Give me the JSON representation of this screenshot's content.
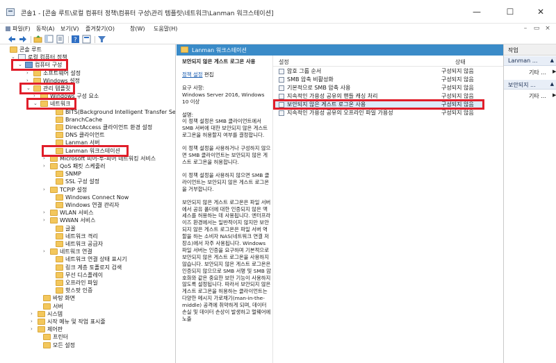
{
  "window": {
    "title": "콘솔1 - [콘솔 루트\\로컬 컴퓨터 정책\\컴퓨터 구성\\관리 템플릿\\네트워크\\Lanman 워크스테이션]",
    "minimize": "—",
    "maximize": "☐",
    "close": "✕"
  },
  "menubar": {
    "items": [
      "파일(F)",
      "동작(A)",
      "보기(V)",
      "즐겨찾기(O)",
      "창(W)",
      "도움말(H)"
    ],
    "mdi": [
      "–",
      "▭",
      "×"
    ]
  },
  "tree": {
    "rows": [
      {
        "label": "콘솔 루트",
        "exp": "",
        "icon": "folder"
      },
      {
        "label": "로컬 컴퓨터 정책",
        "exp": "⌄",
        "icon": "policy"
      },
      {
        "label": "컴퓨터 구성",
        "exp": "⌄",
        "icon": "computer"
      },
      {
        "label": "소프트웨어 설정",
        "exp": "›",
        "icon": "folder"
      },
      {
        "label": "Windows 설정",
        "exp": "›",
        "icon": "folder"
      },
      {
        "label": "관리 템플릿",
        "exp": "⌄",
        "icon": "folder"
      },
      {
        "label": "Windows 구성 요소",
        "exp": "›",
        "icon": "folder"
      },
      {
        "label": "네트워크",
        "exp": "⌄",
        "icon": "folder"
      },
      {
        "label": "BITS(Background Intelligent Transfer Service)",
        "exp": "",
        "icon": "folder"
      },
      {
        "label": "BranchCache",
        "exp": "",
        "icon": "folder"
      },
      {
        "label": "DirectAccess 클라이언트 환경 설정",
        "exp": "",
        "icon": "folder"
      },
      {
        "label": "DNS 클라이언트",
        "exp": "",
        "icon": "folder"
      },
      {
        "label": "Lanman 서버",
        "exp": "",
        "icon": "folder"
      },
      {
        "label": "Lanman 워크스테이션",
        "exp": "",
        "icon": "folder"
      },
      {
        "label": "Microsoft 피어-투-피어 네트워킹 서비스",
        "exp": "›",
        "icon": "folder"
      },
      {
        "label": "QoS 패킷 스케줄러",
        "exp": "›",
        "icon": "folder"
      },
      {
        "label": "SNMP",
        "exp": "",
        "icon": "folder"
      },
      {
        "label": "SSL 구성 설정",
        "exp": "",
        "icon": "folder"
      },
      {
        "label": "TCPIP 설정",
        "exp": "›",
        "icon": "folder"
      },
      {
        "label": "Windows Connect Now",
        "exp": "",
        "icon": "folder"
      },
      {
        "label": "Windows 연결 관리자",
        "exp": "",
        "icon": "folder"
      },
      {
        "label": "WLAN 서비스",
        "exp": "›",
        "icon": "folder"
      },
      {
        "label": "WWAN 서비스",
        "exp": "›",
        "icon": "folder"
      },
      {
        "label": "글꼴",
        "exp": "",
        "icon": "folder"
      },
      {
        "label": "네트워크 격리",
        "exp": "",
        "icon": "folder"
      },
      {
        "label": "네트워크 공급자",
        "exp": "",
        "icon": "folder"
      },
      {
        "label": "네트워크 연결",
        "exp": "›",
        "icon": "folder"
      },
      {
        "label": "네트워크 연결 상태 표시기",
        "exp": "",
        "icon": "folder"
      },
      {
        "label": "링크 계층 토폴로지 검색",
        "exp": "",
        "icon": "folder"
      },
      {
        "label": "무선 디스플레이",
        "exp": "",
        "icon": "folder"
      },
      {
        "label": "오프라인 파일",
        "exp": "",
        "icon": "folder"
      },
      {
        "label": "핫스팟 인증",
        "exp": "",
        "icon": "folder"
      },
      {
        "label": "바탕 화면",
        "exp": "",
        "icon": "folder"
      },
      {
        "label": "서버",
        "exp": "",
        "icon": "folder"
      },
      {
        "label": "시스템",
        "exp": "›",
        "icon": "folder"
      },
      {
        "label": "시작 메뉴 및 작업 표시줄",
        "exp": "›",
        "icon": "folder"
      },
      {
        "label": "제어판",
        "exp": "›",
        "icon": "folder"
      },
      {
        "label": "프린터",
        "exp": "",
        "icon": "folder"
      },
      {
        "label": "모든 설정",
        "exp": "",
        "icon": "folder"
      }
    ]
  },
  "middle": {
    "header": "Lanman 워크스테이션",
    "desc": {
      "title": "보안되지 않은 게스트 로그온 사용",
      "edit_link": "정책 설정",
      "edit_suffix": " 편집",
      "req_label": "요구 사항:",
      "req_text": "Windows Server 2016, Windows 10 이상",
      "desc_label": "설명:",
      "p1": "이 정책 설정은 SMB 클라이언트에서 SMB 서버에 대한 보안되지 않은 게스트 로그온을 허용할지 여부를 결정합니다.",
      "p2": "이 정책 설정을 사용하거나 구성하지 않으면 SMB 클라이언트는 보안되지 않은 게스트 로그온을 허용합니다.",
      "p3": "이 정책 설정을 사용하지 않으면 SMB 클라이언트는 보안되지 않은 게스트 로그온을 거부합니다.",
      "p4": "보안되지 않은 게스트 로그온은 파일 서버에서 공유 폴더에 대한 인증되지 않은 액세스를 허용하는 데 사용됩니다. 엔터프라이즈 환경에서는 일반적이지 않지만 보안되지 않은 게스트 로그온은 파일 서버 역할을 하는 소비자 NAS(네트워크 연결 저장소)에서 자주 사용됩니다. Windows 파일 서버는 인증을 요구하며 기본적으로 보안되지 않은 게스트 로그온을 사용하지 않습니다. 보안되지 않은 게스트 로그온은 인증되지 않으므로 SMB 서명 및 SMB 암호화와 같은 중요한 보안 기능이 사용하지 않도록 설정됩니다. 따라서 보안되지 않은 게스트 로그온을 허용하는 클라이언트는 다양한 메시지 가로채기(man-in-the-middle) 공격에 취약하게 되며, 데이터 손실 및 데이터 손상이 발생하고 멀웨어에 노출"
    },
    "list": {
      "col_setting": "설정",
      "col_state": "상태",
      "rows": [
        {
          "name": "암호 그룹 순서",
          "state": "구성되지 않음"
        },
        {
          "name": "SMB 압축 비활성화",
          "state": "구성되지 않음"
        },
        {
          "name": "기본적으로 SMB 압축 사용",
          "state": "구성되지 않음"
        },
        {
          "name": "지속적인 가용성 공유의 핸들 캐싱 처리",
          "state": "구성되지 않음"
        },
        {
          "name": "보안되지 않은 게스트 로그온 사용",
          "state": "구성되지 않음"
        },
        {
          "name": "지속적인 가용성 공유의 오프라인 파일 가용성",
          "state": "구성되지 않음"
        }
      ]
    }
  },
  "actions": {
    "header": "작업",
    "group1": "Lanman ...",
    "group1_sub": "기타 ...",
    "group2": "보안되지 ...",
    "group2_sub": "기타 ...",
    "arrow_up": "▲",
    "arrow_right": "▶"
  }
}
